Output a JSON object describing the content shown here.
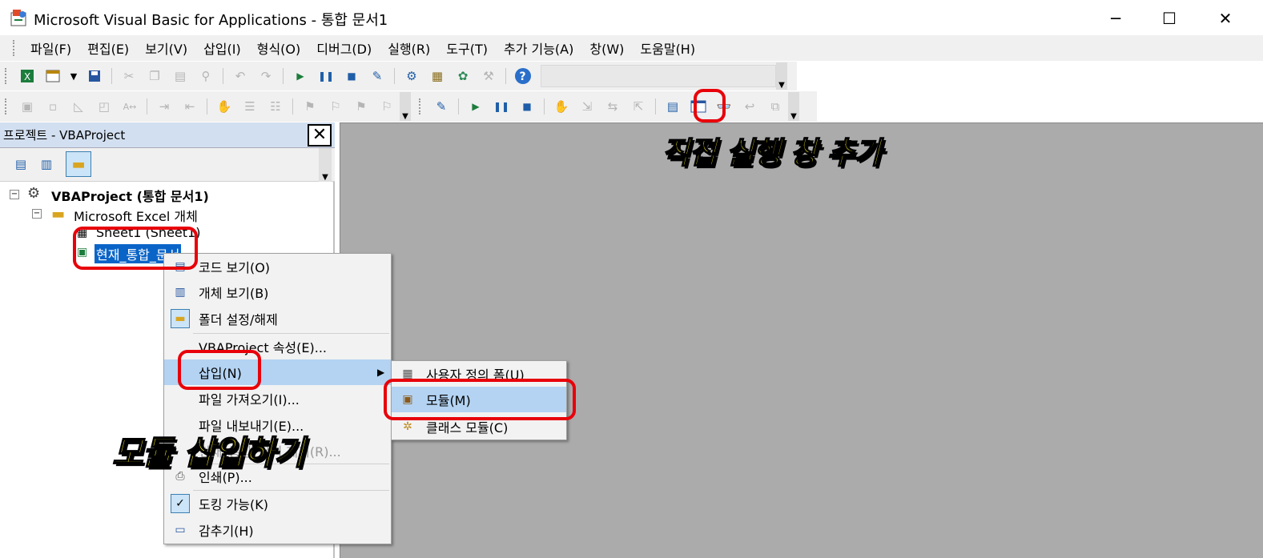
{
  "window": {
    "title": "Microsoft Visual Basic for Applications - 통합 문서1",
    "min": "─",
    "max": "☐",
    "close": "✕"
  },
  "menubar": [
    "파일(F)",
    "편집(E)",
    "보기(V)",
    "삽입(I)",
    "형식(O)",
    "디버그(D)",
    "실행(R)",
    "도구(T)",
    "추가 기능(A)",
    "창(W)",
    "도움말(H)"
  ],
  "toolbar1_icons": [
    "excel-icon",
    "userform-icon",
    "dropdown-icon",
    "save-icon",
    "cut-icon",
    "copy-icon",
    "paste-icon",
    "find-icon",
    "undo-icon",
    "redo-icon",
    "run-icon",
    "break-icon",
    "reset-icon",
    "design-mode-icon",
    "project-explorer-icon",
    "properties-icon",
    "object-browser-icon",
    "toolbox-icon",
    "help-icon"
  ],
  "project": {
    "title": "프로젝트 - VBAProject",
    "close": "✕",
    "tree": {
      "root": "VBAProject (통합 문서1)",
      "folder": "Microsoft Excel 개체",
      "sheet": "Sheet1 (Sheet1)",
      "workbook": "현재_통합_문서"
    }
  },
  "context_menu": {
    "items": [
      "코드 보기(O)",
      "개체 보기(B)",
      "폴더 설정/해제",
      "VBAProject 속성(E)...",
      "삽입(N)",
      "파일 가져오기(I)...",
      "파일 내보내기(E)...",
      "현재_통합_문서 제거(R)...",
      "인쇄(P)...",
      "도킹 가능(K)",
      "감추기(H)"
    ],
    "submenu_arrow": "▶",
    "check": "✓"
  },
  "submenu": {
    "items": [
      "사용자 정의 폼(U)",
      "모듈(M)",
      "클래스 모듈(C)"
    ]
  },
  "annotations": {
    "immediate": "직접 실행 창 추가",
    "insert_module": "모듈 삽입하기"
  },
  "colors": {
    "highlight": "#b4d3f2",
    "annotation_text": "#f7ec1c",
    "annotation_box": "#e8000a",
    "workspace": "#ababab"
  }
}
